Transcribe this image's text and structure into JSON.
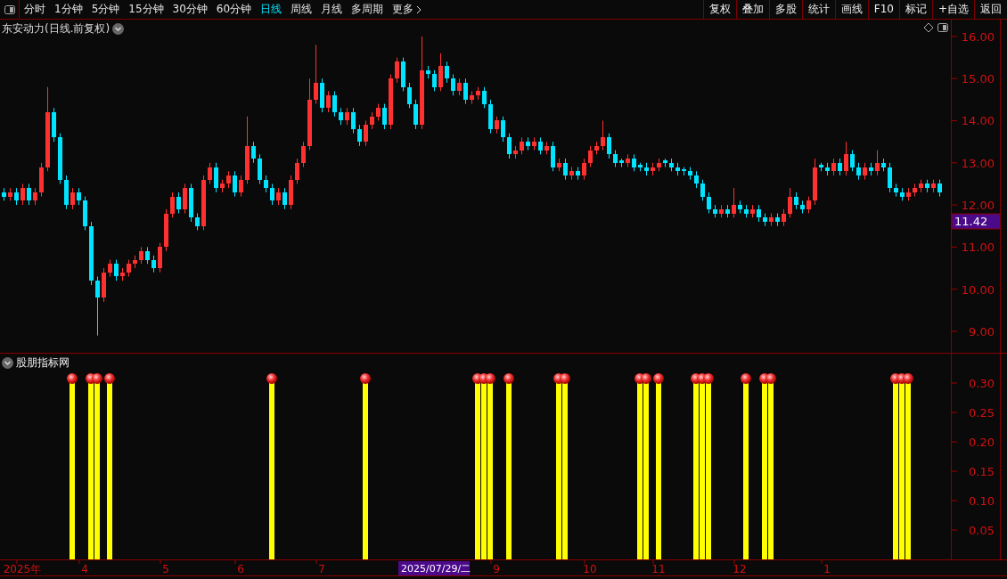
{
  "toolbar": {
    "periods": [
      {
        "label": "分时",
        "selected": false
      },
      {
        "label": "1分钟",
        "selected": false
      },
      {
        "label": "5分钟",
        "selected": false
      },
      {
        "label": "15分钟",
        "selected": false
      },
      {
        "label": "30分钟",
        "selected": false
      },
      {
        "label": "60分钟",
        "selected": false
      },
      {
        "label": "日线",
        "selected": true
      },
      {
        "label": "周线",
        "selected": false
      },
      {
        "label": "月线",
        "selected": false
      },
      {
        "label": "多周期",
        "selected": false
      }
    ],
    "more": "更多",
    "actions": [
      "复权",
      "叠加",
      "多股",
      "统计",
      "画线",
      "F10",
      "标记",
      "+自选",
      "返回"
    ]
  },
  "price_panel": {
    "title": "东安动力(日线.前复权)",
    "current_price": "11.42",
    "chart_data": {
      "type": "candlestick",
      "ylim": [
        8.47,
        16.4
      ],
      "yticks": [
        {
          "value": 16,
          "label": "16.00"
        },
        {
          "value": 15,
          "label": "15.00"
        },
        {
          "value": 14,
          "label": "14.00"
        },
        {
          "value": 13,
          "label": "13.00"
        },
        {
          "value": 12,
          "label": "12.00"
        },
        {
          "value": 11,
          "label": "11.00"
        },
        {
          "value": 10,
          "label": "10.00"
        },
        {
          "value": 9,
          "label": "9.00"
        }
      ],
      "categories": [
        null,
        null,
        null,
        null,
        null,
        null,
        null,
        null,
        null,
        null,
        null,
        null,
        null,
        null,
        null,
        null,
        null,
        null,
        null,
        null,
        null,
        null,
        null,
        null,
        null,
        null,
        null,
        null,
        null,
        null,
        null,
        null,
        null,
        null,
        null,
        null,
        null,
        null,
        null,
        null,
        null,
        null,
        null,
        null,
        null,
        null,
        null,
        null,
        null,
        null,
        null,
        null,
        null,
        null,
        null,
        null,
        null,
        null,
        null,
        null,
        null,
        null,
        null,
        null,
        null,
        null,
        null,
        null,
        null,
        null,
        null,
        null,
        null,
        null,
        null,
        null,
        null,
        null,
        null,
        null,
        null,
        null,
        null,
        null,
        null,
        null,
        null,
        null,
        null,
        null,
        null,
        null,
        null,
        null,
        null,
        null,
        null,
        null,
        null,
        null,
        null,
        null,
        null,
        null,
        null,
        null,
        null,
        null,
        null,
        null,
        null,
        null,
        null,
        null,
        null,
        null,
        null,
        null,
        null,
        null,
        null,
        null,
        null,
        null,
        null,
        null,
        null,
        null,
        null,
        null,
        null,
        null,
        null,
        null,
        null,
        null,
        null,
        null,
        null,
        null,
        null,
        null,
        null,
        null,
        null,
        null,
        null,
        null,
        null,
        null,
        null
      ],
      "ohlc": [
        [
          12.3,
          12.4,
          12.1,
          12.2
        ],
        [
          12.2,
          12.4,
          12.1,
          12.3
        ],
        [
          12.3,
          12.4,
          12.0,
          12.1
        ],
        [
          12.1,
          12.5,
          12.0,
          12.4
        ],
        [
          12.4,
          12.5,
          12.0,
          12.1
        ],
        [
          12.1,
          12.4,
          12.0,
          12.3
        ],
        [
          12.3,
          13.0,
          12.2,
          12.9
        ],
        [
          12.9,
          14.8,
          12.8,
          14.2
        ],
        [
          14.2,
          14.3,
          13.5,
          13.6
        ],
        [
          13.6,
          13.7,
          12.5,
          12.6
        ],
        [
          12.6,
          12.7,
          11.9,
          12.0
        ],
        [
          12.0,
          12.4,
          11.9,
          12.3
        ],
        [
          12.3,
          12.4,
          12.0,
          12.1
        ],
        [
          12.1,
          12.2,
          11.4,
          11.5
        ],
        [
          11.5,
          11.6,
          10.1,
          10.2
        ],
        [
          10.2,
          10.3,
          8.9,
          9.8
        ],
        [
          9.8,
          10.5,
          9.7,
          10.4
        ],
        [
          10.4,
          10.7,
          10.3,
          10.6
        ],
        [
          10.6,
          10.7,
          10.2,
          10.3
        ],
        [
          10.3,
          10.5,
          10.2,
          10.4
        ],
        [
          10.4,
          10.7,
          10.3,
          10.6
        ],
        [
          10.6,
          10.8,
          10.5,
          10.7
        ],
        [
          10.7,
          11.0,
          10.6,
          10.9
        ],
        [
          10.9,
          11.0,
          10.6,
          10.7
        ],
        [
          10.7,
          10.8,
          10.4,
          10.5
        ],
        [
          10.5,
          11.1,
          10.4,
          11.0
        ],
        [
          11.0,
          11.9,
          10.9,
          11.8
        ],
        [
          11.8,
          12.3,
          11.7,
          12.2
        ],
        [
          12.2,
          12.3,
          11.8,
          11.9
        ],
        [
          11.9,
          12.5,
          11.8,
          12.4
        ],
        [
          12.4,
          12.5,
          11.6,
          11.7
        ],
        [
          11.7,
          11.8,
          11.4,
          11.5
        ],
        [
          11.5,
          12.7,
          11.4,
          12.6
        ],
        [
          12.6,
          13.0,
          12.5,
          12.9
        ],
        [
          12.9,
          13.0,
          12.3,
          12.4
        ],
        [
          12.4,
          12.6,
          12.3,
          12.5
        ],
        [
          12.5,
          12.8,
          12.4,
          12.7
        ],
        [
          12.7,
          12.8,
          12.2,
          12.3
        ],
        [
          12.3,
          12.7,
          12.2,
          12.6
        ],
        [
          12.6,
          14.1,
          12.5,
          13.4
        ],
        [
          13.4,
          13.5,
          13.0,
          13.1
        ],
        [
          13.1,
          13.2,
          12.5,
          12.6
        ],
        [
          12.6,
          12.7,
          12.3,
          12.4
        ],
        [
          12.4,
          12.5,
          12.0,
          12.1
        ],
        [
          12.1,
          12.4,
          12.0,
          12.3
        ],
        [
          12.3,
          12.4,
          11.9,
          12.0
        ],
        [
          12.0,
          12.7,
          11.9,
          12.6
        ],
        [
          12.6,
          13.1,
          12.5,
          13.0
        ],
        [
          13.0,
          13.5,
          12.9,
          13.4
        ],
        [
          13.4,
          15.0,
          13.3,
          14.5
        ],
        [
          14.5,
          15.8,
          14.4,
          14.9
        ],
        [
          14.9,
          15.0,
          14.2,
          14.3
        ],
        [
          14.3,
          14.7,
          14.2,
          14.6
        ],
        [
          14.6,
          14.7,
          14.1,
          14.2
        ],
        [
          14.2,
          14.3,
          13.9,
          14.0
        ],
        [
          14.0,
          14.3,
          13.9,
          14.2
        ],
        [
          14.2,
          14.3,
          13.7,
          13.8
        ],
        [
          13.8,
          13.9,
          13.4,
          13.5
        ],
        [
          13.5,
          14.0,
          13.4,
          13.9
        ],
        [
          13.9,
          14.2,
          13.8,
          14.1
        ],
        [
          14.1,
          14.4,
          14.0,
          14.3
        ],
        [
          14.3,
          14.4,
          13.8,
          13.9
        ],
        [
          13.9,
          15.1,
          13.8,
          15.0
        ],
        [
          15.0,
          15.5,
          14.9,
          15.4
        ],
        [
          15.4,
          15.5,
          14.7,
          14.8
        ],
        [
          14.8,
          14.9,
          14.3,
          14.4
        ],
        [
          14.4,
          14.5,
          13.8,
          13.9
        ],
        [
          13.9,
          16.0,
          13.8,
          15.2
        ],
        [
          15.2,
          15.3,
          15.0,
          15.1
        ],
        [
          15.1,
          15.2,
          14.7,
          14.8
        ],
        [
          14.8,
          15.6,
          14.7,
          15.3
        ],
        [
          15.3,
          15.4,
          14.9,
          15.0
        ],
        [
          15.0,
          15.1,
          14.6,
          14.7
        ],
        [
          14.7,
          15.0,
          14.6,
          14.9
        ],
        [
          14.9,
          15.0,
          14.4,
          14.5
        ],
        [
          14.5,
          14.7,
          14.4,
          14.6
        ],
        [
          14.6,
          14.8,
          14.5,
          14.7
        ],
        [
          14.7,
          14.8,
          14.3,
          14.4
        ],
        [
          14.4,
          14.5,
          13.7,
          13.8
        ],
        [
          13.8,
          14.1,
          13.7,
          14.0
        ],
        [
          14.0,
          14.1,
          13.5,
          13.6
        ],
        [
          13.6,
          13.7,
          13.1,
          13.2
        ],
        [
          13.2,
          13.4,
          13.1,
          13.3
        ],
        [
          13.3,
          13.6,
          13.2,
          13.5
        ],
        [
          13.5,
          13.6,
          13.3,
          13.4
        ],
        [
          13.4,
          13.6,
          13.3,
          13.5
        ],
        [
          13.5,
          13.6,
          13.2,
          13.3
        ],
        [
          13.3,
          13.5,
          13.2,
          13.4
        ],
        [
          13.4,
          13.5,
          12.8,
          12.9
        ],
        [
          12.9,
          13.1,
          12.8,
          13.0
        ],
        [
          13.0,
          13.1,
          12.6,
          12.7
        ],
        [
          12.7,
          12.9,
          12.6,
          12.8
        ],
        [
          12.8,
          12.9,
          12.6,
          12.7
        ],
        [
          12.7,
          13.1,
          12.6,
          13.0
        ],
        [
          13.0,
          13.4,
          12.9,
          13.3
        ],
        [
          13.3,
          13.5,
          13.2,
          13.4
        ],
        [
          13.4,
          14.0,
          13.3,
          13.6
        ],
        [
          13.6,
          13.7,
          13.1,
          13.2
        ],
        [
          13.2,
          13.3,
          12.9,
          13.0
        ],
        [
          13.05,
          13.1,
          12.9,
          13.0
        ],
        [
          13.0,
          13.2,
          12.9,
          13.1
        ],
        [
          13.1,
          13.2,
          12.8,
          12.9
        ],
        [
          12.95,
          13.0,
          12.8,
          12.9
        ],
        [
          12.9,
          13.0,
          12.7,
          12.8
        ],
        [
          12.8,
          13.0,
          12.7,
          12.9
        ],
        [
          12.9,
          13.1,
          12.8,
          13.0
        ],
        [
          13.05,
          13.1,
          12.9,
          13.0
        ],
        [
          13.0,
          13.1,
          12.8,
          12.9
        ],
        [
          12.9,
          13.0,
          12.7,
          12.8
        ],
        [
          12.85,
          12.9,
          12.7,
          12.8
        ],
        [
          12.8,
          12.9,
          12.6,
          12.7
        ],
        [
          12.7,
          12.8,
          12.4,
          12.5
        ],
        [
          12.5,
          12.6,
          12.1,
          12.2
        ],
        [
          12.2,
          12.3,
          11.8,
          11.9
        ],
        [
          11.9,
          12.0,
          11.7,
          11.8
        ],
        [
          11.8,
          12.0,
          11.7,
          11.9
        ],
        [
          11.9,
          12.0,
          11.7,
          11.8
        ],
        [
          11.8,
          12.4,
          11.7,
          12.0
        ],
        [
          12.0,
          12.1,
          11.8,
          11.9
        ],
        [
          11.9,
          12.0,
          11.7,
          11.8
        ],
        [
          11.8,
          12.0,
          11.7,
          11.9
        ],
        [
          11.9,
          12.0,
          11.6,
          11.7
        ],
        [
          11.7,
          11.8,
          11.5,
          11.6
        ],
        [
          11.6,
          11.8,
          11.5,
          11.7
        ],
        [
          11.7,
          11.8,
          11.5,
          11.6
        ],
        [
          11.6,
          11.9,
          11.5,
          11.8
        ],
        [
          11.8,
          12.4,
          11.7,
          12.2
        ],
        [
          12.2,
          12.3,
          11.9,
          12.0
        ],
        [
          12.0,
          12.1,
          11.8,
          11.9
        ],
        [
          11.9,
          12.2,
          11.8,
          12.1
        ],
        [
          12.1,
          13.1,
          12.0,
          12.9
        ],
        [
          12.95,
          13.0,
          12.8,
          12.9
        ],
        [
          12.9,
          13.0,
          12.7,
          12.8
        ],
        [
          12.8,
          13.1,
          12.7,
          13.0
        ],
        [
          13.0,
          13.1,
          12.7,
          12.8
        ],
        [
          12.8,
          13.5,
          12.7,
          13.2
        ],
        [
          13.2,
          13.3,
          12.8,
          12.9
        ],
        [
          12.9,
          13.0,
          12.6,
          12.7
        ],
        [
          12.7,
          13.0,
          12.6,
          12.9
        ],
        [
          12.9,
          13.0,
          12.7,
          12.8
        ],
        [
          12.8,
          13.3,
          12.7,
          13.0
        ],
        [
          13.0,
          13.1,
          12.8,
          12.9
        ],
        [
          12.9,
          13.0,
          12.3,
          12.4
        ],
        [
          12.4,
          12.5,
          12.2,
          12.3
        ],
        [
          12.3,
          12.4,
          12.1,
          12.2
        ],
        [
          12.2,
          12.4,
          12.1,
          12.3
        ],
        [
          12.3,
          12.5,
          12.2,
          12.4
        ],
        [
          12.4,
          12.6,
          12.3,
          12.5
        ],
        [
          12.5,
          12.6,
          12.3,
          12.4
        ],
        [
          12.4,
          12.6,
          12.3,
          12.5
        ],
        [
          12.5,
          12.6,
          12.2,
          12.3
        ]
      ]
    }
  },
  "indicator_panel": {
    "title": "股朋指标网",
    "cursor_date": "2025/07/29/二",
    "chart_data": {
      "type": "bar",
      "ylim": [
        0,
        0.35
      ],
      "yticks": [
        {
          "value": 0.3,
          "label": "0.30"
        },
        {
          "value": 0.25,
          "label": "0.25"
        },
        {
          "value": 0.2,
          "label": "0.20"
        },
        {
          "value": 0.15,
          "label": "0.15"
        },
        {
          "value": 0.1,
          "label": "0.10"
        },
        {
          "value": 0.05,
          "label": "0.05"
        }
      ],
      "categories": [
        null,
        null,
        null,
        "2025年",
        null,
        null,
        null,
        null,
        null,
        null,
        null,
        null,
        null,
        "4",
        null,
        null,
        null,
        null,
        null,
        null,
        null,
        null,
        null,
        null,
        null,
        null,
        "5",
        null,
        null,
        null,
        null,
        null,
        null,
        null,
        null,
        null,
        null,
        null,
        "6",
        null,
        null,
        null,
        null,
        null,
        null,
        null,
        null,
        null,
        null,
        null,
        null,
        "7",
        null,
        null,
        null,
        null,
        null,
        null,
        null,
        null,
        null,
        null,
        null,
        null,
        null,
        null,
        null,
        null,
        null,
        null,
        null,
        null,
        null,
        null,
        null,
        null,
        null,
        null,
        null,
        "9",
        null,
        null,
        null,
        null,
        null,
        null,
        null,
        null,
        null,
        null,
        null,
        null,
        null,
        null,
        "10",
        null,
        null,
        null,
        null,
        null,
        null,
        null,
        null,
        null,
        null,
        "11",
        null,
        null,
        null,
        null,
        null,
        null,
        null,
        null,
        null,
        null,
        null,
        null,
        "12",
        null,
        null,
        null,
        null,
        null,
        null,
        null,
        null,
        null,
        null,
        null,
        null,
        null,
        "1",
        null,
        null,
        null,
        null,
        null,
        null,
        null,
        null,
        null,
        null,
        null,
        null,
        null,
        null,
        null,
        null,
        null,
        null
      ],
      "series": [
        {
          "color": "#ffff00",
          "values": [
            null,
            null,
            null,
            null,
            null,
            null,
            null,
            null,
            null,
            null,
            null,
            0.3,
            null,
            null,
            0.3,
            0.3,
            null,
            0.3,
            null,
            null,
            null,
            null,
            null,
            null,
            null,
            null,
            null,
            null,
            null,
            null,
            null,
            null,
            null,
            null,
            null,
            null,
            null,
            null,
            null,
            null,
            null,
            null,
            null,
            0.3,
            null,
            null,
            null,
            null,
            null,
            null,
            null,
            null,
            null,
            null,
            null,
            null,
            null,
            null,
            0.3,
            null,
            null,
            null,
            null,
            null,
            null,
            null,
            null,
            null,
            null,
            null,
            null,
            null,
            null,
            null,
            null,
            null,
            0.3,
            0.3,
            0.3,
            null,
            null,
            0.3,
            null,
            null,
            null,
            null,
            null,
            null,
            null,
            0.3,
            0.3,
            null,
            null,
            null,
            null,
            null,
            null,
            null,
            null,
            null,
            null,
            null,
            0.3,
            0.3,
            null,
            0.3,
            null,
            null,
            null,
            null,
            null,
            0.3,
            0.3,
            0.3,
            null,
            null,
            null,
            null,
            null,
            0.3,
            null,
            null,
            0.3,
            0.3,
            null,
            null,
            null,
            null,
            null,
            null,
            null,
            null,
            null,
            null,
            null,
            null,
            null,
            null,
            null,
            null,
            null,
            null,
            null,
            0.3,
            0.3,
            0.3,
            null,
            null,
            null,
            null,
            null
          ]
        }
      ]
    }
  }
}
